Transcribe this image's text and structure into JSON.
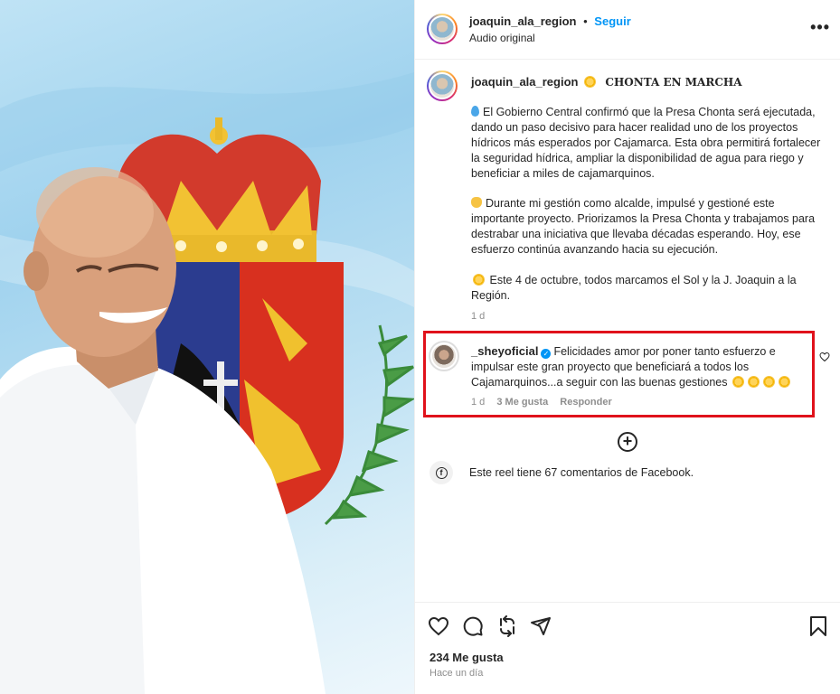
{
  "post": {
    "username": "joaquin_ala_region",
    "follow_label": "Seguir",
    "separator": "•",
    "audio": "Audio original",
    "more_label": "•••"
  },
  "caption": {
    "username": "joaquin_ala_region",
    "title": "CHONTA EN MARCHA",
    "paragraph1": "El Gobierno Central confirmó que la Presa Chonta será ejecutada, dando un paso decisivo para hacer realidad uno de los proyectos hídricos más esperados por Cajamarca. Esta obra permitirá fortalecer la seguridad hídrica, ampliar la disponibilidad de agua para riego y beneficiar a miles de cajamarquinos.",
    "paragraph2": "Durante mi gestión como alcalde, impulsé y gestioné este importante proyecto. Priorizamos la Presa Chonta y trabajamos para destrabar una iniciativa que llevaba décadas esperando. Hoy, ese esfuerzo continúa avanzando hacia su ejecución.",
    "paragraph3": "Este 4 de octubre, todos marcamos el Sol y la J. Joaquin a la Región.",
    "time": "1 d"
  },
  "comment": {
    "username": "_sheyoficial",
    "text": "Felicidades amor por poner tanto esfuerzo e impulsar este gran proyecto que beneficiará a todos los Cajamarquinos...a seguir con las buenas gestiones",
    "time": "1 d",
    "likes": "3 Me gusta",
    "reply_label": "Responder"
  },
  "facebook_note": "Este reel tiene 67 comentarios de Facebook.",
  "footer": {
    "likes": "234 Me gusta",
    "posted_ago": "Hace un día"
  },
  "icons": {
    "more": "more-icon",
    "heart": "heart-icon",
    "comment": "comment-icon",
    "repost": "repost-icon",
    "share": "share-icon",
    "save": "bookmark-icon",
    "add": "plus-circle-icon",
    "facebook": "facebook-icon"
  },
  "colors": {
    "accent": "#0095f6",
    "highlight_border": "#e0121b",
    "text": "#262626",
    "muted": "#8e8e8e"
  }
}
